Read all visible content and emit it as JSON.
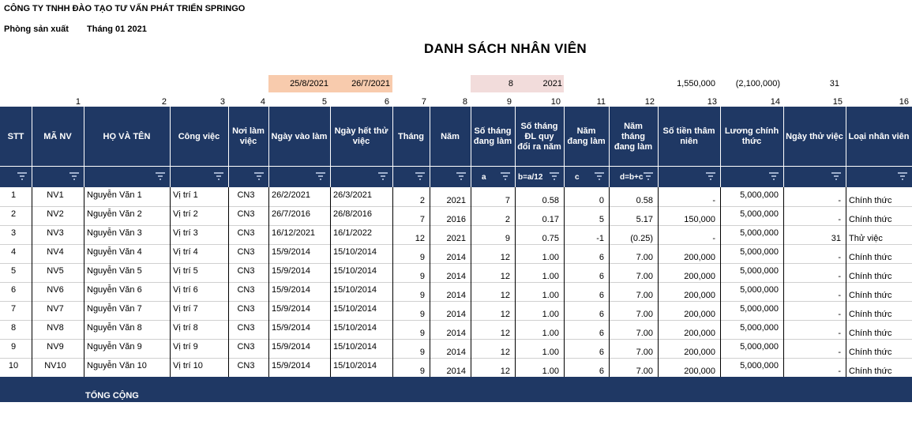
{
  "header": {
    "company": "CÔNG TY TNHH ĐÀO TẠO TƯ VẤN PHÁT TRIỂN SPRINGO",
    "department": "Phòng sản xuất",
    "month": "Tháng 01 2021",
    "title": "DANH SÁCH NHÂN VIÊN"
  },
  "params": {
    "date1": "25/8/2021",
    "date2": "26/7/2021",
    "month_num": "8",
    "year_num": "2021",
    "seniority": "1,550,000",
    "neg_value": "(2,100,000)",
    "days": "31"
  },
  "col_numbers": [
    "1",
    "2",
    "3",
    "4",
    "5",
    "6",
    "7",
    "8",
    "9",
    "10",
    "11",
    "12",
    "13",
    "14",
    "15",
    "16"
  ],
  "columns": [
    "STT",
    "MÃ NV",
    "HỌ VÀ TÊN",
    "Công việc",
    "Nơi làm việc",
    "Ngày vào làm",
    "Ngày hết thử việc",
    "Tháng",
    "Năm",
    "Số tháng đang làm",
    "Số tháng ĐL quy đổi ra năm",
    "Năm đang làm",
    "Năm tháng đang làm",
    "Số tiền thâm niên",
    "Lương chính thức",
    "Ngày thử việc",
    "Loại nhân viên"
  ],
  "formula_labels": {
    "a": "a",
    "b": "b=a/12",
    "c": "c",
    "d": "d=b+c"
  },
  "rows": [
    [
      "1",
      "NV1",
      "Nguyễn Văn 1",
      "Vị trí 1",
      "CN3",
      "26/2/2021",
      "26/3/2021",
      "2",
      "2021",
      "7",
      "0.58",
      "0",
      "0.58",
      "-",
      "5,000,000",
      "-",
      "Chính thức"
    ],
    [
      "2",
      "NV2",
      "Nguyễn Văn 2",
      "Vị trí 2",
      "CN3",
      "26/7/2016",
      "26/8/2016",
      "7",
      "2016",
      "2",
      "0.17",
      "5",
      "5.17",
      "150,000",
      "5,000,000",
      "-",
      "Chính thức"
    ],
    [
      "3",
      "NV3",
      "Nguyễn Văn 3",
      "Vị trí 3",
      "CN3",
      "16/12/2021",
      "16/1/2022",
      "12",
      "2021",
      "9",
      "0.75",
      "-1",
      "(0.25)",
      "-",
      "5,000,000",
      "31",
      "Thử việc"
    ],
    [
      "4",
      "NV4",
      "Nguyễn Văn 4",
      "Vị trí 4",
      "CN3",
      "15/9/2014",
      "15/10/2014",
      "9",
      "2014",
      "12",
      "1.00",
      "6",
      "7.00",
      "200,000",
      "5,000,000",
      "-",
      "Chính thức"
    ],
    [
      "5",
      "NV5",
      "Nguyễn Văn 5",
      "Vị trí 5",
      "CN3",
      "15/9/2014",
      "15/10/2014",
      "9",
      "2014",
      "12",
      "1.00",
      "6",
      "7.00",
      "200,000",
      "5,000,000",
      "-",
      "Chính thức"
    ],
    [
      "6",
      "NV6",
      "Nguyễn Văn 6",
      "Vị trí 6",
      "CN3",
      "15/9/2014",
      "15/10/2014",
      "9",
      "2014",
      "12",
      "1.00",
      "6",
      "7.00",
      "200,000",
      "5,000,000",
      "-",
      "Chính thức"
    ],
    [
      "7",
      "NV7",
      "Nguyễn Văn 7",
      "Vị trí 7",
      "CN3",
      "15/9/2014",
      "15/10/2014",
      "9",
      "2014",
      "12",
      "1.00",
      "6",
      "7.00",
      "200,000",
      "5,000,000",
      "-",
      "Chính thức"
    ],
    [
      "8",
      "NV8",
      "Nguyễn Văn 8",
      "Vị trí 8",
      "CN3",
      "15/9/2014",
      "15/10/2014",
      "9",
      "2014",
      "12",
      "1.00",
      "6",
      "7.00",
      "200,000",
      "5,000,000",
      "-",
      "Chính thức"
    ],
    [
      "9",
      "NV9",
      "Nguyễn Văn 9",
      "Vị trí 9",
      "CN3",
      "15/9/2014",
      "15/10/2014",
      "9",
      "2014",
      "12",
      "1.00",
      "6",
      "7.00",
      "200,000",
      "5,000,000",
      "-",
      "Chính thức"
    ],
    [
      "10",
      "NV10",
      "Nguyễn Văn 10",
      "Vị trí 10",
      "CN3",
      "15/9/2014",
      "15/10/2014",
      "9",
      "2014",
      "12",
      "1.00",
      "6",
      "7.00",
      "200,000",
      "5,000,000",
      "-",
      "Chính thức"
    ]
  ],
  "total_label": "TỔNG CỘNG"
}
